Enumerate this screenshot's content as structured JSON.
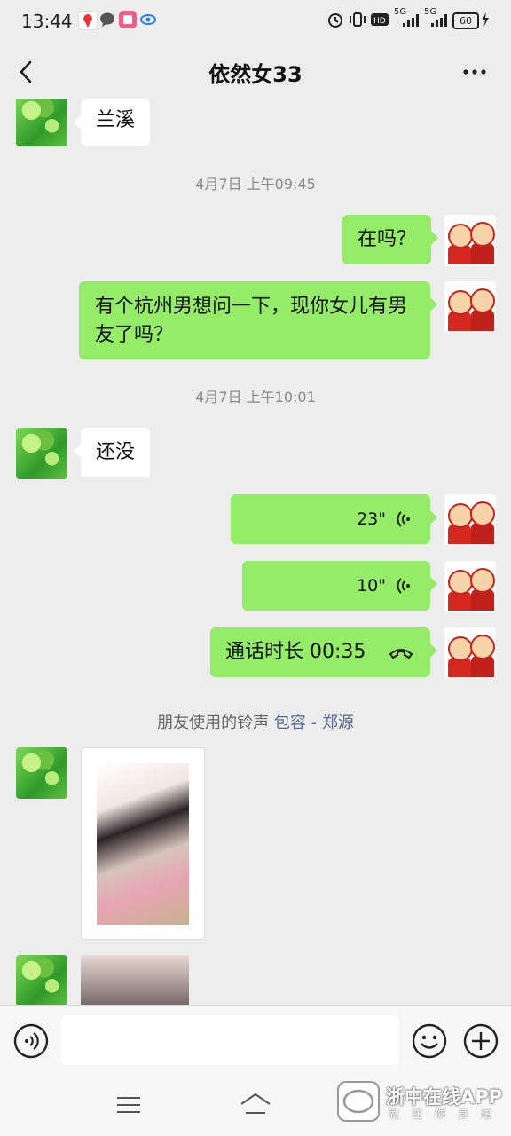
{
  "status_bar": {
    "time": "13:44",
    "network_1": "5G",
    "network_2": "5G",
    "battery": "60"
  },
  "header": {
    "title": "依然女33"
  },
  "messages": {
    "m1": "兰溪",
    "ts1": "4月7日 上午09:45",
    "m2": "在吗？",
    "m3": "有个杭州男想问一下，现你女儿有男友了吗？",
    "ts2": "4月7日 上午10:01",
    "m4": "还没",
    "voice1": "23\"",
    "voice2": "10\"",
    "call": "通话时长 00:35"
  },
  "ringtone_note": {
    "prefix": "朋友使用的铃声",
    "song": "包容 - 郑源"
  },
  "watermark": {
    "logo_text": "n",
    "title": "浙中在线APP",
    "subtitle": "就在你身边"
  },
  "colors": {
    "out_bubble": "#95ec69",
    "in_bubble": "#ffffff",
    "link": "#576b95"
  }
}
